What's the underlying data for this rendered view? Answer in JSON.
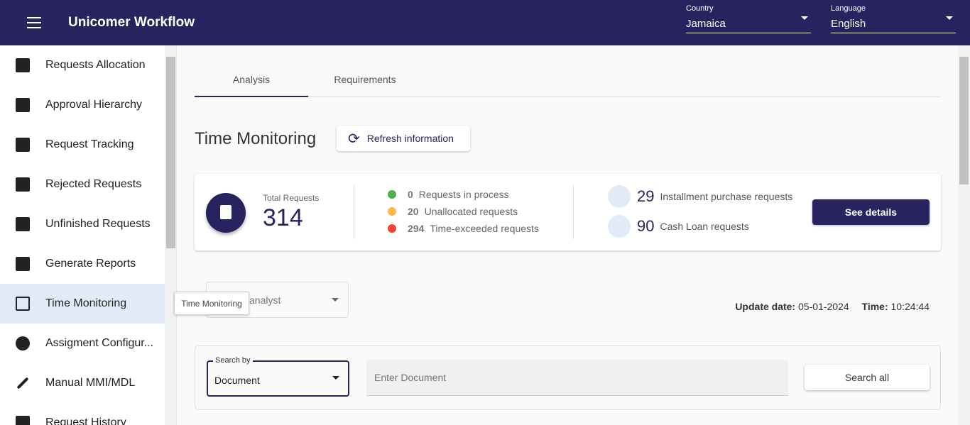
{
  "header": {
    "title": "Unicomer Workflow",
    "country_label": "Country",
    "country_value": "Jamaica",
    "language_label": "Language",
    "language_value": "English"
  },
  "sidebar": {
    "items": [
      {
        "label": "Requests Allocation",
        "icon": "assignment-ind-icon"
      },
      {
        "label": "Approval Hierarchy",
        "icon": "hierarchy-icon"
      },
      {
        "label": "Request Tracking",
        "icon": "clipboard-list-icon"
      },
      {
        "label": "Rejected Requests",
        "icon": "clipboard-alert-icon"
      },
      {
        "label": "Unfinished Requests",
        "icon": "clipboard-return-icon"
      },
      {
        "label": "Generate Reports",
        "icon": "bar-chart-icon"
      },
      {
        "label": "Time Monitoring",
        "icon": "clipboard-clock-icon",
        "active": true
      },
      {
        "label": "Assigment Configur...",
        "icon": "gear-icon"
      },
      {
        "label": "Manual MMI/MDL",
        "icon": "pencil-icon"
      },
      {
        "label": "Request History",
        "icon": "list-search-icon"
      }
    ]
  },
  "tooltip": "Time Monitoring",
  "tabs": [
    {
      "label": "Analysis",
      "active": true
    },
    {
      "label": "Requirements"
    }
  ],
  "page_title": "Time Monitoring",
  "refresh_label": "Refresh information",
  "summary": {
    "total_label": "Total Requests",
    "total_value": "314",
    "statuses": [
      {
        "count": "0",
        "label": "Requests in process",
        "color": "#4caf50"
      },
      {
        "count": "20",
        "label": "Unallocated requests",
        "color": "#ffb74d"
      },
      {
        "count": "294",
        "label": "Time-exceeded requests",
        "color": "#f44336"
      }
    ],
    "products": [
      {
        "count": "29",
        "label": "Installment purchase requests",
        "icon": "shopping-bag-icon"
      },
      {
        "count": "90",
        "label": "Cash Loan requests",
        "icon": "cash-icon"
      }
    ],
    "details_label": "See details"
  },
  "analyst_select": {
    "value": "analyst"
  },
  "update": {
    "date_label": "Update date:",
    "date": "05-01-2024",
    "time_label": "Time:",
    "time": "10:24:44"
  },
  "search": {
    "by_label": "Search by",
    "by_value": "Document",
    "placeholder": "Enter Document",
    "search_all_label": "Search all"
  },
  "colors": {
    "primary": "#28235f",
    "active_bg": "#e1ebf8"
  }
}
